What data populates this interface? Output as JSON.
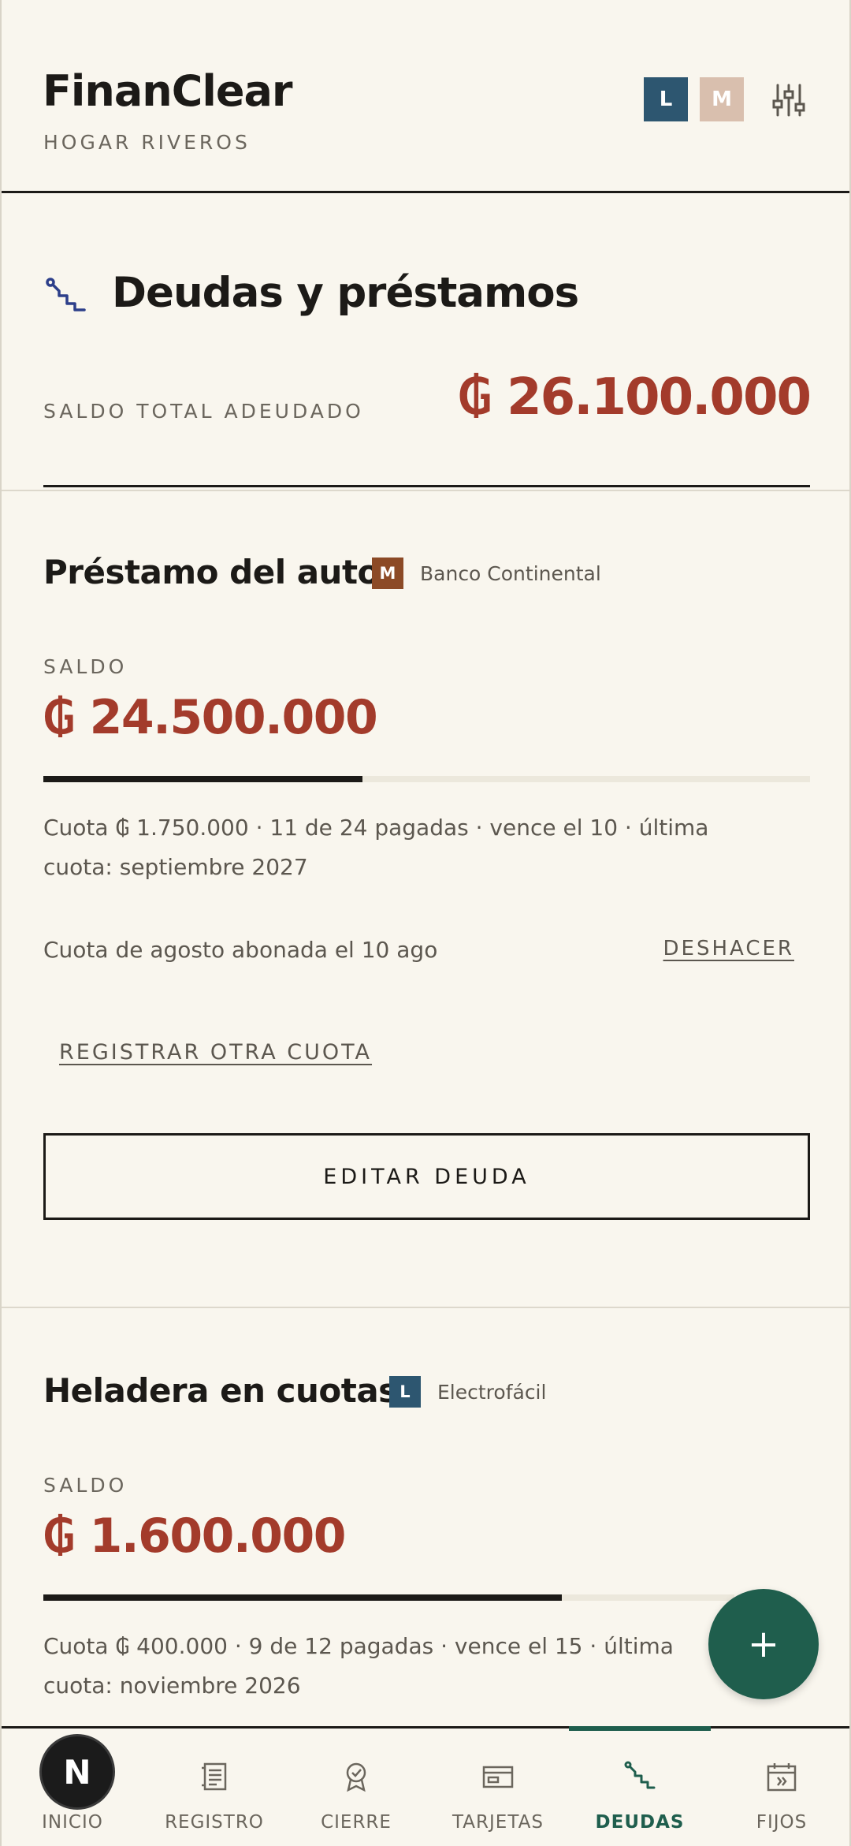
{
  "header": {
    "app_name": "FinanClear",
    "household": "HOGAR RIVEROS",
    "avatars": [
      "L",
      "M"
    ]
  },
  "summary": {
    "title": "Deudas y préstamos",
    "total_label": "SALDO TOTAL ADEUDADO",
    "total_value": "₲ 26.100.000"
  },
  "debts": [
    {
      "name": "Préstamo del auto",
      "owner": "M",
      "lender": "Banco Continental",
      "saldo_label": "SALDO",
      "saldo": "₲ 24.500.000",
      "progress": 0.4167,
      "details": "Cuota ₲ 1.750.000 · 11 de 24 pagadas · vence el 10 · última cuota: septiembre 2027",
      "paid_note": "Cuota de agosto abonada el 10 ago",
      "undo_label": "DESHACER",
      "another_label": "REGISTRAR OTRA CUOTA",
      "edit_label": "EDITAR DEUDA"
    },
    {
      "name": "Heladera en cuotas",
      "owner": "L",
      "lender": "Electrofácil",
      "saldo_label": "SALDO",
      "saldo": "₲ 1.600.000",
      "progress": 0.75,
      "details": "Cuota ₲ 400.000 · 9 de 12 pagadas · vence el 15 · última cuota: noviembre 2026"
    }
  ],
  "fab": {
    "label": "+"
  },
  "nav": {
    "items": [
      {
        "label": "INICIO",
        "icon": "home-icon"
      },
      {
        "label": "REGISTRO",
        "icon": "ledger-icon"
      },
      {
        "label": "CIERRE",
        "icon": "badge-icon"
      },
      {
        "label": "TARJETAS",
        "icon": "card-icon"
      },
      {
        "label": "DEUDAS",
        "icon": "steps-icon"
      },
      {
        "label": "FIJOS",
        "icon": "calendar-icon"
      }
    ],
    "active": "DEUDAS"
  },
  "dev_badge": "N",
  "colors": {
    "background": "#f9f6ee",
    "accent": "#1f5e4d",
    "debt_red": "#a33b2b",
    "owner_l": "#2d5670",
    "owner_m": "#8c4a26"
  }
}
